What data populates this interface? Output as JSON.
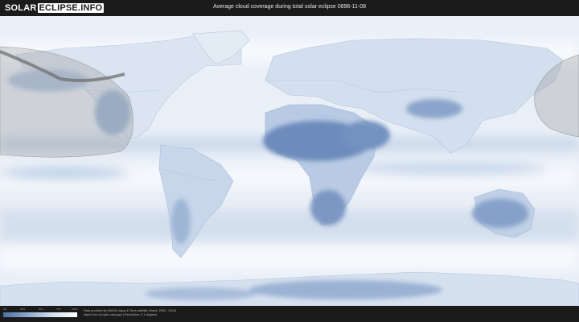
{
  "header": {
    "logo_part1": "SOLAR",
    "logo_part2": "ECLIPSE.INFO",
    "title": "Average cloud coverage during total solar eclipse 0896-11-08"
  },
  "legend": {
    "ticks": [
      "0%",
      "25%",
      "50%",
      "75%",
      "100%"
    ],
    "colors": [
      "#4b6fa6",
      "#8ea9cf",
      "#d4e0ee",
      "#ffffff"
    ]
  },
  "footer": {
    "credit_line1": "Data provided by NASA's Aqua & Terra satellite (Years: 2000 - 2019)",
    "credit_line2": "https://neo.sci.gsfc.nasa.gov | Resolution: 0.1 degrees"
  },
  "map": {
    "ocean_color": "#e9eff7",
    "cloudy_color": "#f6f9fc",
    "clear_color": "#6f8fbe",
    "eclipse_path_color": "#8a8a8a"
  }
}
